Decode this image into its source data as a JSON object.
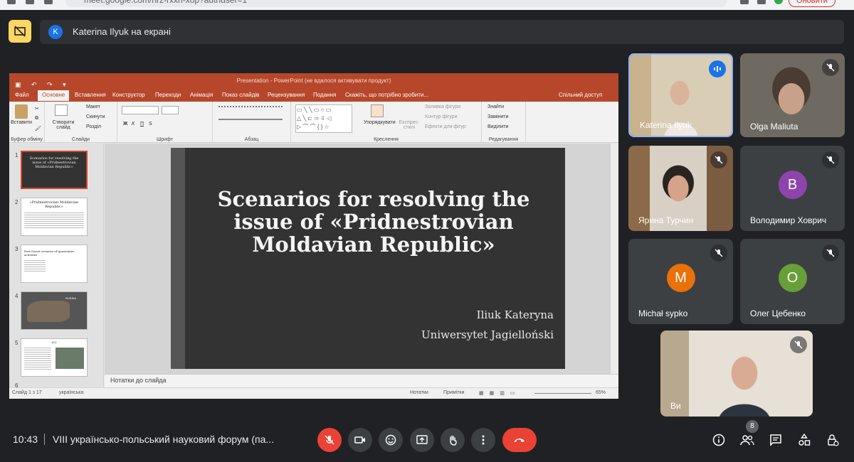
{
  "browser": {
    "url": "meet.google.com/nrz-rxxh-xop?authuser=1",
    "update_label": "Оновити"
  },
  "banner": {
    "avatar_letter": "K",
    "text": "Katerina Ilyuk на екрані"
  },
  "ppt": {
    "title": "Presentation - PowerPoint (не вдалося активувати продукт)",
    "menu": [
      "Файл",
      "Основне",
      "Вставлення",
      "Конструктор",
      "Переходи",
      "Анімація",
      "Показ слайдів",
      "Рецензування",
      "Подання",
      "Скажіть, що потрібно зробити...",
      "Спільний доступ"
    ],
    "ribbon": {
      "clipboard": {
        "paste": "Вставити",
        "caption": "Буфер обміну"
      },
      "slides": {
        "new": "Створити слайд",
        "layout": "Макет",
        "reset": "Скинути",
        "section": "Розділ",
        "caption": "Слайди"
      },
      "font": {
        "bold": "Ж",
        "italic": "К",
        "underline": "П",
        "strike": "S",
        "caption": "Шрифт"
      },
      "paragraph": {
        "caption": "Абзац"
      },
      "drawing": {
        "arrange": "Упорядкувати",
        "styles": "Експрес-стилі",
        "fill": "Заливка фігури",
        "outline": "Контур фігури",
        "effects": "Ефекти для фігур",
        "caption": "Креслення"
      },
      "editing": {
        "find": "Знайти",
        "replace": "Замінити",
        "select": "Виділити",
        "caption": "Редагування"
      }
    },
    "thumbs": [
      {
        "num": "1",
        "title": "Scenarios for resolving the issue of «Pridnestrovian Moldavian Republic»"
      },
      {
        "num": "2",
        "title": "«Pridnestrovian Moldavian Republic»"
      },
      {
        "num": "3",
        "title": "Post-Soviet scenario of quasistates activities"
      },
      {
        "num": "4",
        "title": "RUSSIA"
      },
      {
        "num": "5",
        "title": "JCC"
      },
      {
        "num": "6",
        "title": ""
      }
    ],
    "slide": {
      "title": "Scenarios for resolving the issue of «Pridnestrovian Moldavian Republic»",
      "author": "Iliuk Kateryna",
      "affiliation": "Uniwersytet Jagielloński"
    },
    "notes_placeholder": "Нотатки до слайда",
    "status": {
      "slide": "Слайд 1 з 17",
      "lang": "українська",
      "notes": "Нотатки",
      "comments": "Примітки",
      "zoom": "65%"
    }
  },
  "participants": [
    {
      "name": "Katerina Ilyuk",
      "speaking": true
    },
    {
      "name": "Olga Maliuta",
      "muted": true
    },
    {
      "name": "Ярина Турчин",
      "muted": true
    },
    {
      "name": "Володимир Ховрич",
      "letter": "В",
      "color": "#8e44ad",
      "muted": true
    },
    {
      "name": "Michał sypko",
      "letter": "M",
      "color": "#e8710a",
      "muted": true
    },
    {
      "name": "Олег Цебенко",
      "letter": "O",
      "color": "#689f38",
      "muted": true
    },
    {
      "name": "Ви",
      "muted": true
    }
  ],
  "bottom": {
    "time": "10:43",
    "meeting": "VIII українсько-польський науковий форум (па...",
    "people_count": "8"
  }
}
